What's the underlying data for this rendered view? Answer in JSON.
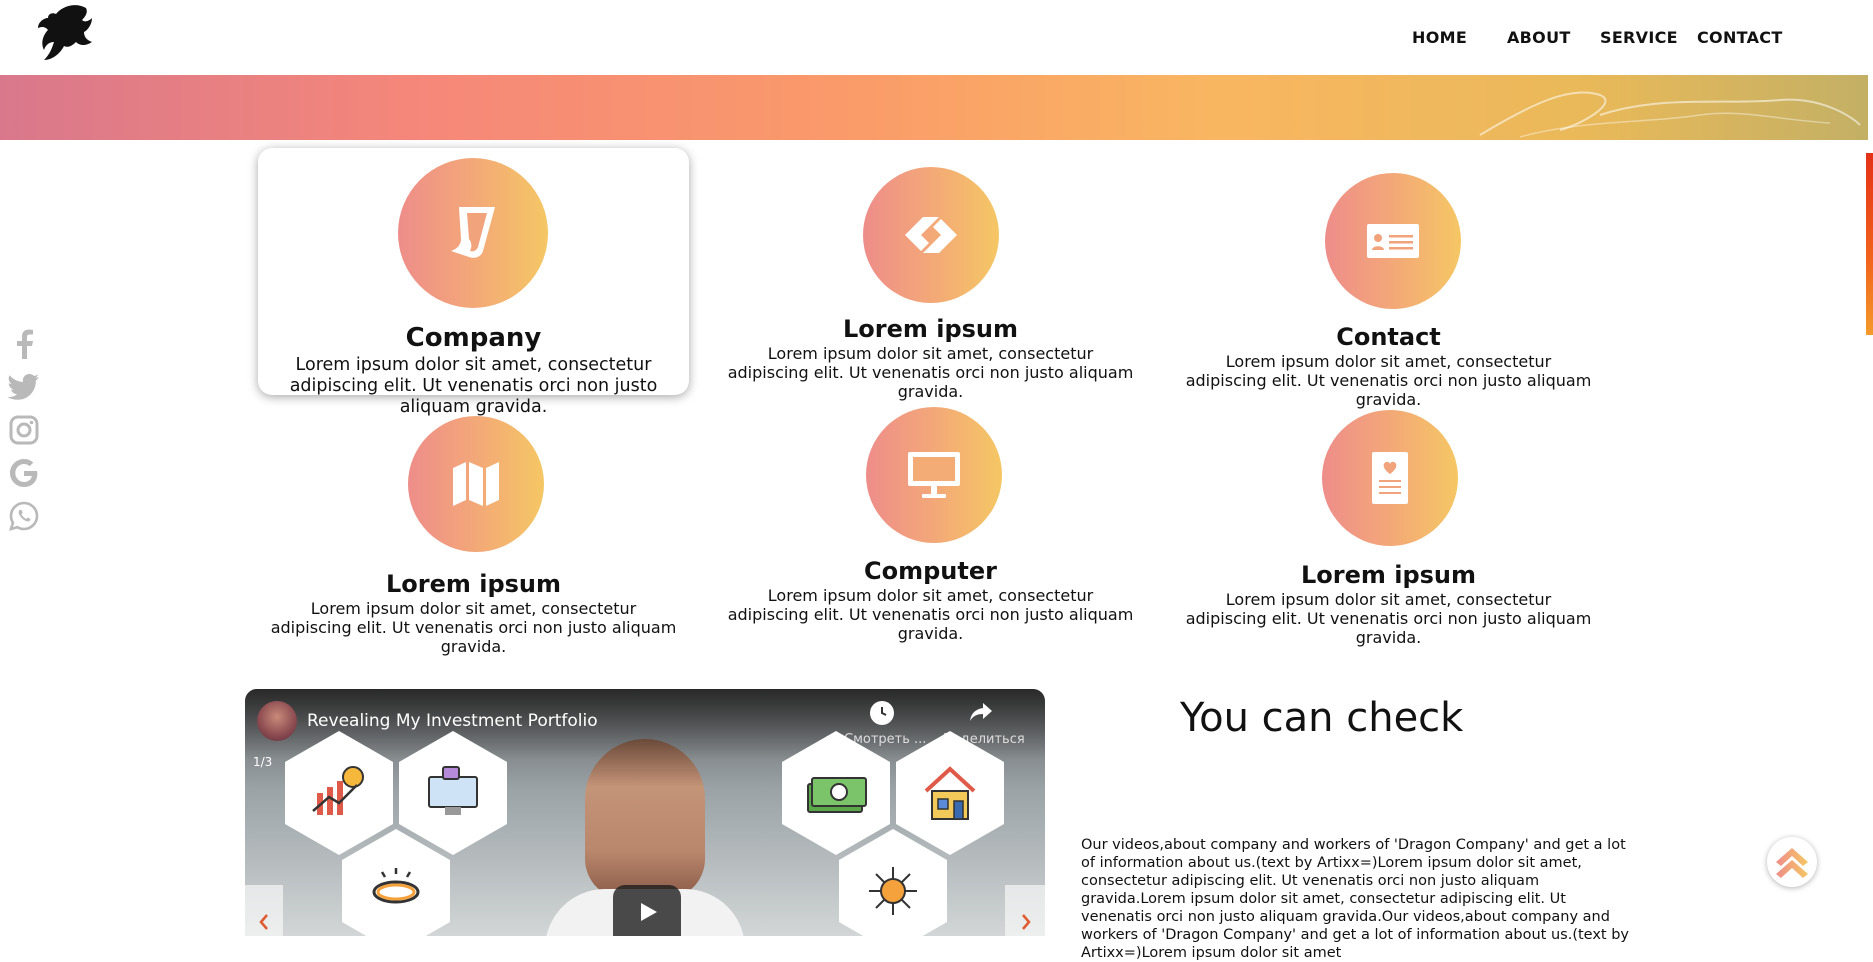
{
  "nav": {
    "home": "HOME",
    "about": "ABOUT",
    "service": "SERVICE",
    "contact": "CONTACT"
  },
  "social": [
    "facebook-icon",
    "twitter-icon",
    "instagram-icon",
    "google-icon",
    "whatsapp-icon"
  ],
  "services": [
    {
      "title": "Company",
      "text": "Lorem ipsum dolor sit amet, consectetur adipiscing elit. Ut venenatis orci non justo aliquam gravida.",
      "icon": "scroll-icon"
    },
    {
      "title": "Lorem ipsum",
      "text": "Lorem ipsum dolor sit amet, consectetur adipiscing elit. Ut venenatis orci non justo aliquam gravida.",
      "icon": "link-icon"
    },
    {
      "title": "Contact",
      "text": "Lorem ipsum dolor sit amet, consectetur adipiscing elit. Ut venenatis orci non justo aliquam gravida.",
      "icon": "id-card-icon"
    },
    {
      "title": "Lorem ipsum",
      "text": "Lorem ipsum dolor sit amet, consectetur adipiscing elit. Ut venenatis orci non justo aliquam gravida.",
      "icon": "map-icon"
    },
    {
      "title": "Computer",
      "text": "Lorem ipsum dolor sit amet, consectetur adipiscing elit. Ut venenatis orci non justo aliquam gravida.",
      "icon": "monitor-icon"
    },
    {
      "title": "Lorem ipsum",
      "text": "Lorem ipsum dolor sit amet, consectetur adipiscing elit. Ut venenatis orci non justo aliquam gravida.",
      "icon": "heart-document-icon"
    }
  ],
  "video": {
    "title": "Revealing My Investment Portfolio",
    "counter": "1/3",
    "watch_later": "Смотреть ...",
    "share": "Поделиться"
  },
  "check": {
    "title": "You can check",
    "text": "Our videos,about company and workers of 'Dragon Company' and get a lot of information about us.(text by Artixx=)Lorem ipsum dolor sit amet, consectetur adipiscing elit. Ut venenatis orci non justo aliquam gravida.Lorem ipsum dolor sit amet, consectetur adipiscing elit. Ut venenatis orci non justo aliquam gravida.Our videos,about company and workers of 'Dragon Company' and get a lot of information about us.(text by Artixx=)Lorem ipsum dolor sit amet"
  },
  "colors": {
    "accent_start": "#ee8d8a",
    "accent_end": "#f5c764",
    "scroll_accent": "#e53017"
  }
}
